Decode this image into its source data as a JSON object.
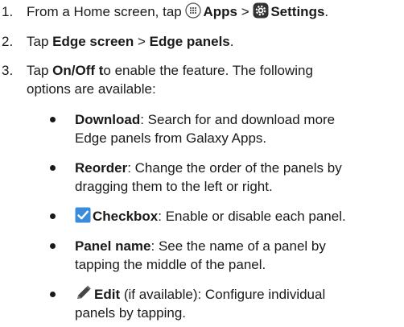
{
  "steps": [
    {
      "number": "1.",
      "prefix": "From a Home screen, tap ",
      "apps_label": "Apps",
      "sep": " > ",
      "settings_label": "Settings",
      "suffix": ".",
      "icons": [
        "apps-grid-icon",
        "settings-gear-icon"
      ]
    },
    {
      "number": "2.",
      "prefix": "Tap ",
      "edge_screen": "Edge screen",
      "sep": " > ",
      "edge_panels": "Edge panels",
      "suffix": "."
    },
    {
      "number": "3.",
      "prefix": "Tap ",
      "onoff": "On/Off t",
      "line1_rest": "o enable the feature. The following",
      "line2": "options are available:"
    }
  ],
  "options": [
    {
      "term": "Download",
      "line1": ": Search for and download more",
      "line2": "Edge panels from Galaxy Apps."
    },
    {
      "term": "Reorder",
      "line1": ": Change the order of the panels by",
      "line2": "dragging them to the left or right."
    },
    {
      "term": "Checkbox",
      "line1": ": Enable or disable each panel.",
      "icon": "checkbox-icon"
    },
    {
      "term": "Panel name",
      "line1": ": See the name of a panel by",
      "line2": "tapping the middle of the panel."
    },
    {
      "term": "Edit",
      "line1": " (if available): Configure individual",
      "line2": "panels by tapping.",
      "icon": "pencil-icon"
    }
  ],
  "colors": {
    "text": "#1a1a1a",
    "checkbox": "#3b8ddb",
    "icon_dark": "#333333"
  }
}
